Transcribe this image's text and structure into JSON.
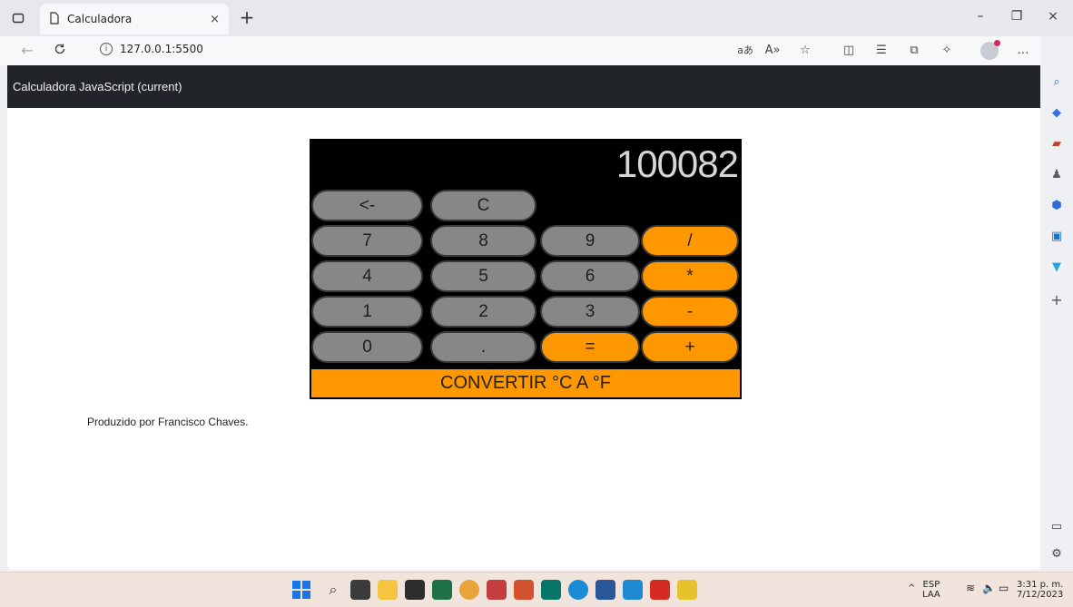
{
  "browser": {
    "tab_title": "Calculadora",
    "tab_close": "×",
    "new_tab": "+",
    "url": "127.0.0.1:5500",
    "minimize": "–",
    "restore": "❐",
    "close": "×"
  },
  "page": {
    "brand": "Calculadora JavaScript (current)",
    "footer": "Produzido por Francisco Chaves."
  },
  "calculator": {
    "display": "100082",
    "rows": [
      [
        "<-",
        "C"
      ],
      [
        "7",
        "8",
        "9",
        "/"
      ],
      [
        "4",
        "5",
        "6",
        "*"
      ],
      [
        "1",
        "2",
        "3",
        "-"
      ],
      [
        "0",
        ".",
        "=",
        "+"
      ]
    ],
    "convert_label": "CONVERTIR °C A °F"
  },
  "taskbar": {
    "lang_top": "ESP",
    "lang_bottom": "LAA",
    "time": "3:31 p. m.",
    "date": "7/12/2023",
    "tray_up": "^"
  },
  "colors": {
    "accent": "#ff9800",
    "key_gray": "#878787",
    "navbar": "#212529"
  },
  "icons": {
    "tab_actions": "tab-actions-icon",
    "page": "page-icon",
    "back": "back-icon",
    "refresh": "refresh-icon",
    "info": "info-icon"
  }
}
